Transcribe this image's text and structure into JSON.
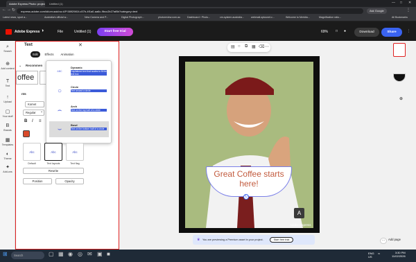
{
  "browser": {
    "tabs": [
      "Adobe Express Photo: project...",
      "Untitled (1)"
    ],
    "url": "express.adobe.com/id/urn:aaid:sc:AP:5892981f-c57b-4f1a0-aa6c-9bcc2b27af8b?category=text",
    "ask_google": "Ask Google",
    "bookmarks": [
      "Latest news, sport a...",
      "Australia's official w...",
      "New Camera and P...",
      "Digital Photograph...",
      "photoreview.com.au",
      "Dashboard ‹ Photo...",
      "cm-system.australia...",
      "webmail.optusnet.c...",
      "Welcome to Meridia...",
      "Magnification ratio..."
    ],
    "all_bookmarks": "All Bookmarks",
    "window_controls": [
      "—",
      "□",
      "✕"
    ]
  },
  "app": {
    "brand": "Adobe Express",
    "file_menu": "File",
    "doc_title": "Untitled (1)",
    "trial_button": "Start free trial",
    "zoom": "69%",
    "download": "Download",
    "share": "Share"
  },
  "rail": {
    "items": [
      {
        "label": "Search",
        "icon": "search-icon",
        "glyph": "⌕"
      },
      {
        "label": "Add content",
        "icon": "add-icon",
        "glyph": "⊕"
      },
      {
        "label": "Text",
        "icon": "text-icon",
        "glyph": "T"
      },
      {
        "label": "Upload",
        "icon": "upload-icon",
        "glyph": "↑"
      },
      {
        "label": "Your stuff",
        "icon": "folder-icon",
        "glyph": "▢"
      },
      {
        "label": "Brands",
        "icon": "brand-icon",
        "glyph": "B"
      },
      {
        "label": "Templates",
        "icon": "templates-icon",
        "glyph": "▦"
      },
      {
        "label": "Theme",
        "icon": "theme-icon",
        "glyph": "◐"
      },
      {
        "label": "Add-ons",
        "icon": "addons-icon",
        "glyph": "✦"
      }
    ]
  },
  "panel": {
    "title": "Text",
    "tabs": [
      "Edit",
      "Effects",
      "Animation"
    ],
    "recommended": "Recommen",
    "swatch_text": "offee",
    "fonts_label": "nts",
    "font_field": "Komet",
    "weight_field": "Regular",
    "layout_cards": [
      {
        "label": "Default",
        "preview": "Abc"
      },
      {
        "label": "Text layouts",
        "preview": "Abc"
      },
      {
        "label": "Text flag",
        "preview": "Abc"
      }
    ],
    "buttons": {
      "rewrite": "Rewrite",
      "position": "Position",
      "opacity": "Opacity"
    }
  },
  "layouts_popup": {
    "items": [
      {
        "name": "Dynamic",
        "desc": "Capitalized text that scales to fit the text box",
        "thumb": "ABC"
      },
      {
        "name": "Circle",
        "desc": "Text around a circle",
        "thumb": "○"
      },
      {
        "name": "Arch",
        "desc": "Text on the top half of a circle",
        "thumb": "⌢"
      },
      {
        "name": "Bowl",
        "desc": "Text on the bottom half of a circle",
        "thumb": "⌣"
      }
    ]
  },
  "canvas": {
    "caption": "Great Coffee starts here!",
    "watermark": "Adobe Express",
    "premium_note": "You are previewing a Premium asset in your project.",
    "premium_button": "Start free trial",
    "add_page": "Add page"
  },
  "taskbar": {
    "search": "Search",
    "language": [
      "ENG",
      "US"
    ],
    "time": "3:30 PM",
    "date": "11/02/2026"
  },
  "colors": {
    "accent": "#3a63f0",
    "trial_gradient_start": "#7b3ff2",
    "trial_gradient_end": "#d14bd5",
    "caption_text": "#c25a3d",
    "photo_background": "#a4b978",
    "panel_highlight": "#e02020"
  }
}
